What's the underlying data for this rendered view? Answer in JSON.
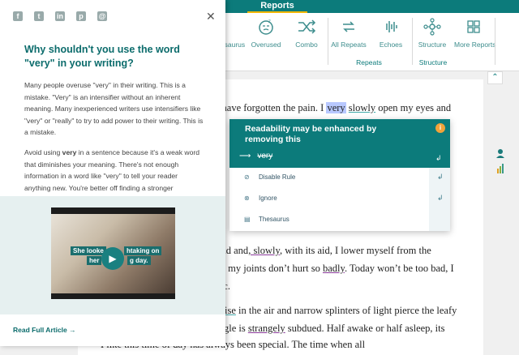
{
  "toolbar": {
    "active_tab": "Reports",
    "items": [
      {
        "label": "Thesaurus",
        "icon": "thesaurus-icon"
      },
      {
        "label": "Overused",
        "icon": "overused-icon"
      },
      {
        "label": "Combo",
        "icon": "combo-icon"
      },
      {
        "label": "All Repeats",
        "icon": "all-repeats-icon"
      },
      {
        "label": "Echoes",
        "icon": "echoes-icon"
      },
      {
        "label": "Structure",
        "icon": "structure-icon"
      },
      {
        "label": "More Reports",
        "icon": "more-reports-icon"
      }
    ],
    "groups": {
      "repeats": "Repeats",
      "structure": "Structure"
    }
  },
  "panel": {
    "title": "Why shouldn't you use the word \"very\" in your writing?",
    "p1": "Many people overuse \"very\" in their writing. This is a mistake. \"Very\" is an intensifier without an inherent meaning. Many inexperienced writers use intensifiers like \"very\" or \"really\" to try to add power to their writing. This is a mistake.",
    "p2_a": "Avoid using ",
    "p2_b": "very",
    "p2_c": " in a sentence because it's a weak word that diminishes your meaning. There's not enough information in a word like \"very\" to tell your reader anything new. You're better off finding a stronger adjective.",
    "video_caption_left": "She looke",
    "video_caption_right": "htaking on",
    "video_caption_left2": "her",
    "video_caption_right2": "g day.",
    "read_full": "Read Full Article →"
  },
  "popup": {
    "title": "Readability may be enhanced by removing this",
    "suggestion_arrow": "⟶",
    "suggestion_word": "very",
    "actions": [
      "Disable Rule",
      "Ignore",
      "Thesaurus"
    ]
  },
  "document": {
    "l1a": ", I have forgotten the pain. I ",
    "l1b": "very",
    "l1c": " ",
    "l1d": "slowly",
    "l1e": " open my eyes and",
    "l5a": "ound and",
    "l5b": ", slowly",
    "l5c": ", with its aid, I lower myself from the",
    "l6a": "one my joints don’t hurt so ",
    "l6b": "badly",
    "l6c": ". Today won’t be too bad, I",
    "l7": "istic.",
    "l8a": "to rise",
    "l8b": " in the air and narrow splinters of light pierce the leafy",
    "l9a": " jungle is ",
    "l9b": "strangely",
    "l9c": " subdued. Half awake or half asleep, its",
    "l10": "I like this time of day has always been special. The time when all"
  },
  "colors": {
    "teal": "#0c7b7b",
    "accent": "#f2b705",
    "highlight": "#b8c8ff"
  }
}
